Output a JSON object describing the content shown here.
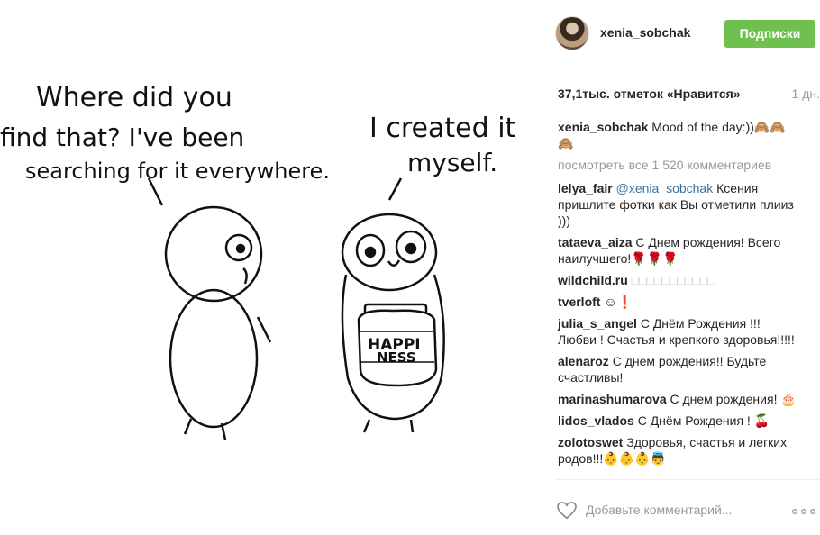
{
  "image": {
    "left_speech": [
      "Where did you",
      "find that? I've been",
      "searching for it everywhere."
    ],
    "right_speech": [
      "I created it",
      "myself."
    ],
    "jar_label": [
      "HAPPI",
      "NESS"
    ]
  },
  "header": {
    "username": "xenia_sobchak",
    "follow_label": "Подписки"
  },
  "post": {
    "likes": "37,1тыс. отметок «Нравится»",
    "time": "1 дн."
  },
  "comments": {
    "caption": {
      "user": "xenia_sobchak",
      "text": "Mood of the day:))🙈🙈🙈"
    },
    "view_all": "посмотреть все 1 520 комментариев",
    "items": [
      {
        "user": "lelya_fair",
        "mention": "@xenia_sobchak",
        "text": "Ксения пришлите фотки как Вы отметили плииз )))"
      },
      {
        "user": "tataeva_aiza",
        "text": "С Днем рождения! Всего наилучшего!🌹🌹🌹"
      },
      {
        "user": "wildchild.ru",
        "text": "□□□□□□□□□□□"
      },
      {
        "user": "tverloft",
        "text": "☺❗"
      },
      {
        "user": "julia_s_angel",
        "text": "С Днём Рождения !!! Любви ! Счастья и крепкого здоровья!!!!!"
      },
      {
        "user": "alenaroz",
        "text": "С днем рождения!! Будьте счастливы!"
      },
      {
        "user": "marinashumarova",
        "text": "С днем рождения! 🎂"
      },
      {
        "user": "lidos_vlados",
        "text": "С Днём Рождения ! 🍒"
      },
      {
        "user": "zolotoswet",
        "text": "Здоровья, счастья и легких родов!!!👶👶👶👼"
      }
    ]
  },
  "add_comment": {
    "placeholder": "Добавьте комментарий..."
  }
}
